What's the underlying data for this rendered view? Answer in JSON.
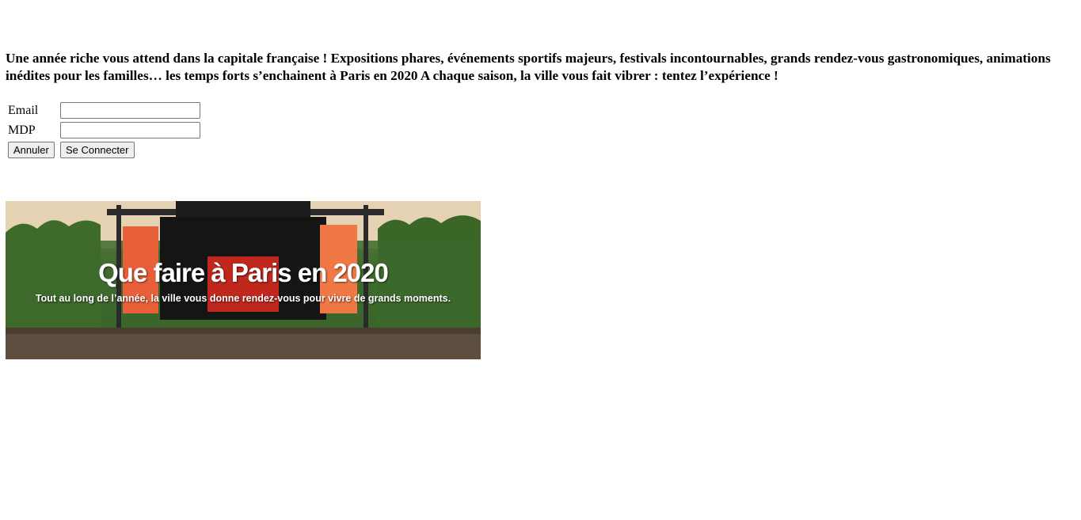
{
  "intro": {
    "text": "Une année riche vous attend dans la capitale française ! Expositions phares, événements sportifs majeurs, festivals incontournables, grands rendez-vous gastronomiques, animations inédites pour les familles… les temps forts s’enchainent à Paris en 2020 A chaque saison, la ville vous fait vibrer : tentez l’expérience !"
  },
  "login": {
    "email_label": "Email",
    "email_value": "",
    "password_label": "MDP",
    "password_value": "",
    "cancel_label": "Annuler",
    "submit_label": "Se Connecter"
  },
  "banner": {
    "title": "Que faire à Paris en 2020",
    "subtitle": "Tout au long de l’année, la ville vous donne rendez-vous pour vivre de grands moments."
  }
}
